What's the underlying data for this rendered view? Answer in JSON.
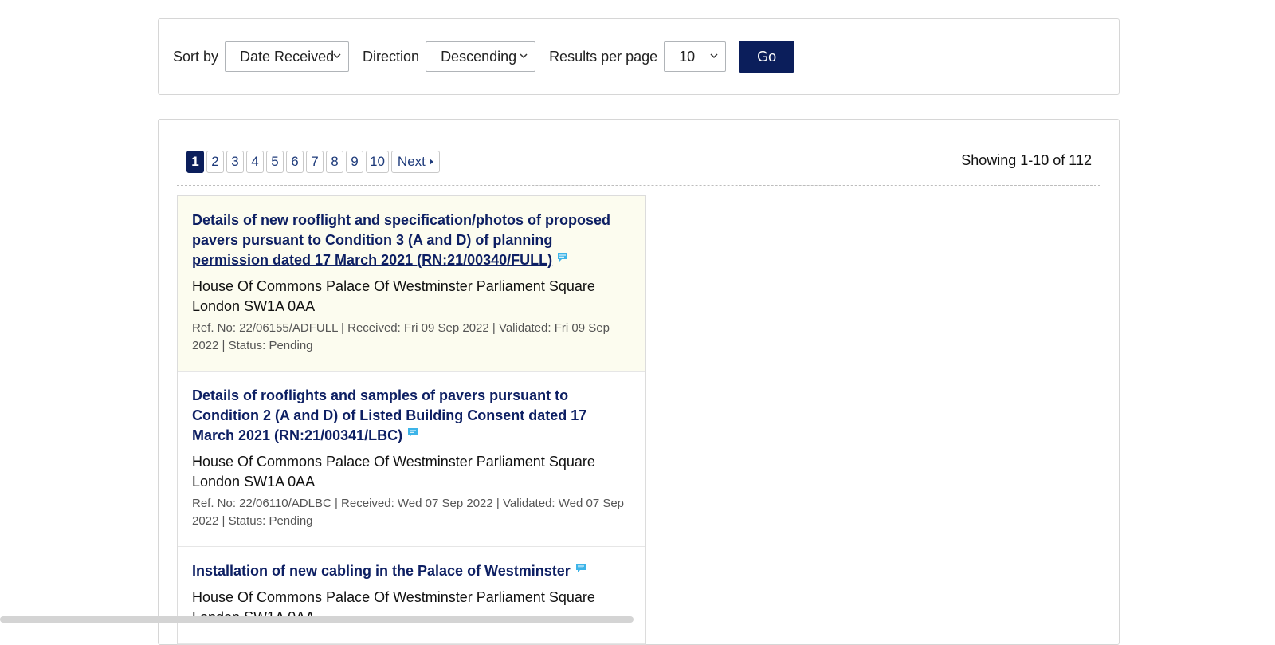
{
  "sort": {
    "sort_by_label": "Sort by",
    "sort_by_value": "Date Received",
    "direction_label": "Direction",
    "direction_value": "Descending",
    "per_page_label": "Results per page",
    "per_page_value": "10",
    "go_label": "Go"
  },
  "pagination": {
    "pages": [
      "1",
      "2",
      "3",
      "4",
      "5",
      "6",
      "7",
      "8",
      "9",
      "10"
    ],
    "current": "1",
    "next_label": "Next",
    "showing": "Showing 1-10  of 112"
  },
  "results": [
    {
      "title": "Details of new rooflight and specification/photos of proposed pavers pursuant to Condition 3 (A and D) of planning permission dated 17 March 2021 (RN:21/00340/FULL)",
      "address": "House Of Commons Palace Of Westminster Parliament Square London SW1A 0AA",
      "meta": "Ref. No: 22/06155/ADFULL | Received: Fri 09 Sep 2022 | Validated: Fri 09 Sep 2022 | Status: Pending"
    },
    {
      "title": "Details of rooflights and samples of pavers pursuant to Condition 2 (A and D) of Listed Building Consent dated 17 March 2021 (RN:21/00341/LBC)",
      "address": "House Of Commons Palace Of Westminster Parliament Square London SW1A 0AA",
      "meta": "Ref. No: 22/06110/ADLBC | Received: Wed 07 Sep 2022 | Validated: Wed 07 Sep 2022 | Status: Pending"
    },
    {
      "title": "Installation of new cabling in the Palace of Westminster",
      "address": "House Of Commons Palace Of Westminster Parliament Square London SW1A 0AA",
      "meta": ""
    }
  ],
  "icons": {
    "dropdown": "chevron-down-icon",
    "comment": "comment-icon",
    "next": "triangle-right-icon"
  },
  "colors": {
    "brand": "#0b1e5b",
    "link": "#0d1f63",
    "highlight_bg": "#fcfcef",
    "comment_icon": "#3db4e8"
  }
}
